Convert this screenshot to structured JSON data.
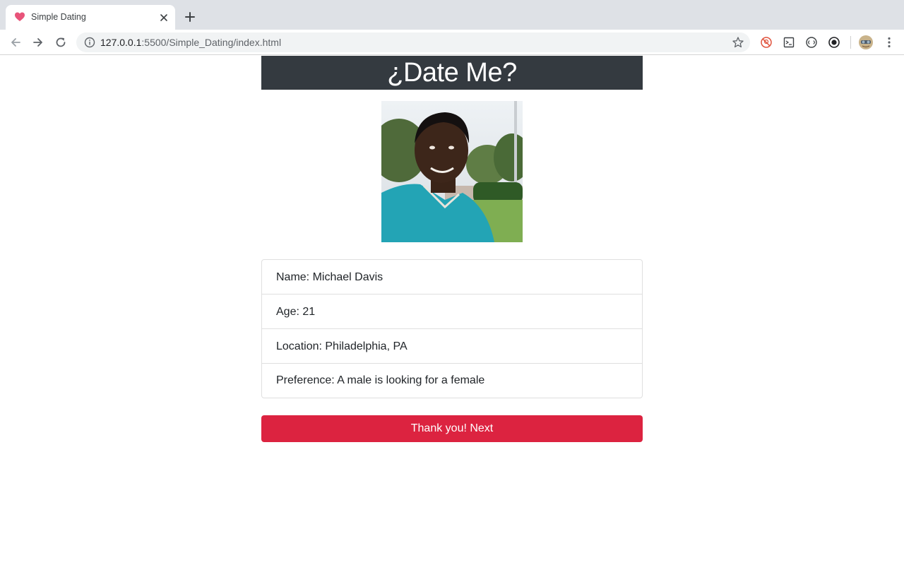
{
  "browser": {
    "tab_title": "Simple Dating",
    "url_host": "127.0.0.1",
    "url_rest": ":5500/Simple_Dating/index.html"
  },
  "page": {
    "header": "¿Date Me?",
    "profile": [
      {
        "label": "Name",
        "value": "Michael Davis",
        "text": "Name: Michael Davis"
      },
      {
        "label": "Age",
        "value": "21",
        "text": "Age: 21"
      },
      {
        "label": "Location",
        "value": "Philadelphia, PA",
        "text": "Location: Philadelphia, PA"
      },
      {
        "label": "Preference",
        "value": "A male is looking for a female",
        "text": "Preference: A male is looking for a female"
      }
    ],
    "next_button": "Thank you! Next"
  },
  "colors": {
    "header_bg": "#343a40",
    "button_bg": "#dc2340",
    "favicon": "#e8547a"
  },
  "icons": [
    "heart-favicon-icon",
    "close-icon",
    "plus-icon",
    "back-icon",
    "forward-icon",
    "reload-icon",
    "info-icon",
    "star-icon",
    "extension-icon",
    "avatar",
    "menu-icon"
  ]
}
